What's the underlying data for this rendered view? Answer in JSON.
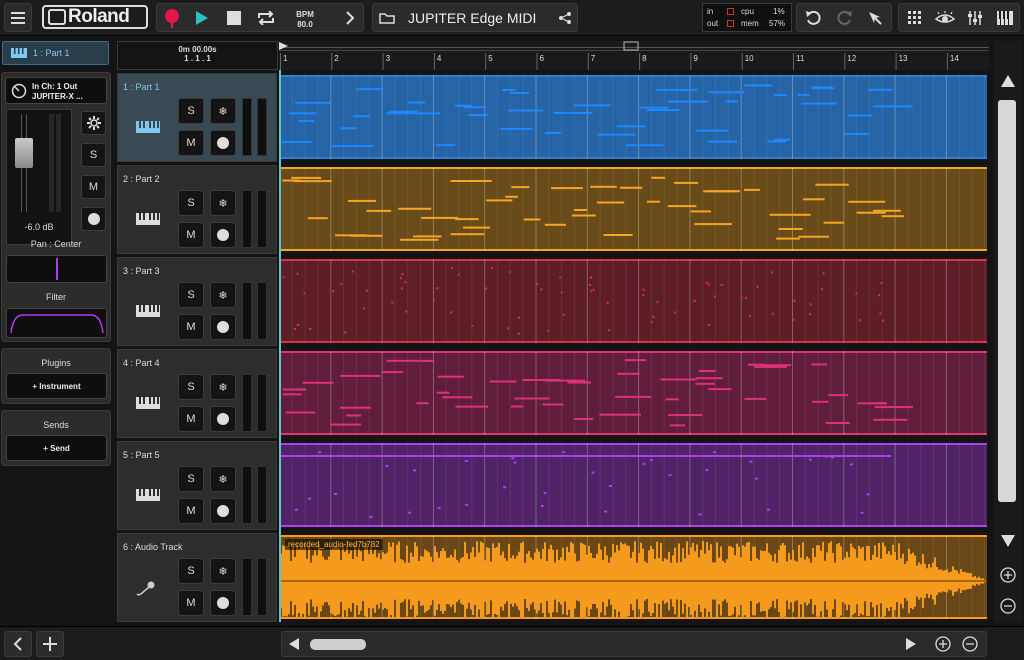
{
  "topbar": {
    "menu_icon": "hamburger-menu-icon",
    "brand": "Roland",
    "bpm_label": "BPM",
    "bpm_value": "80.0",
    "song_title": "JUPITER Edge MIDI",
    "meters": {
      "in": "in",
      "out": "out",
      "cpu_label": "cpu",
      "cpu_value": "1%",
      "mem_label": "mem",
      "mem_value": "57%"
    }
  },
  "inspector": {
    "tab_label": "1 : Part 1",
    "io_line1": "In  Ch: 1 Out",
    "io_line2": "JUPITER-X ...",
    "volume": "-6.0 dB",
    "solo": "S",
    "mute": "M",
    "pan_label": "Pan : Center",
    "filter_label": "Filter",
    "plugins_label": "Plugins",
    "add_instrument": "+ Instrument",
    "sends_label": "Sends",
    "add_send": "+ Send"
  },
  "transport": {
    "time": "0m 00.00s",
    "position": "1 . 1 . 1"
  },
  "ruler": {
    "bars": [
      "1",
      "2",
      "3",
      "4",
      "5",
      "6",
      "7",
      "8",
      "9",
      "10",
      "11",
      "12",
      "13",
      "14"
    ]
  },
  "tracks": [
    {
      "name": "1 : Part 1",
      "color": "#2e7fd6",
      "type": "midi",
      "selected": true
    },
    {
      "name": "2 : Part 2",
      "color": "#f5a524",
      "type": "midi",
      "selected": false
    },
    {
      "name": "3 : Part 3",
      "color": "#d8304a",
      "type": "midi",
      "selected": false
    },
    {
      "name": "4 : Part 4",
      "color": "#e0307a",
      "type": "midi",
      "selected": false
    },
    {
      "name": "5 : Part 5",
      "color": "#b23cf0",
      "type": "midi",
      "selected": false
    },
    {
      "name": "6 : Audio Track",
      "color": "#f59a1c",
      "type": "audio",
      "selected": false
    }
  ],
  "track_buttons": {
    "solo": "S",
    "mute": "M"
  },
  "audio_clip_label": "recorded_audio-fed7b782",
  "icons": {
    "record": "record-icon",
    "play": "play-icon",
    "stop": "stop-icon",
    "loop": "loop-icon",
    "forward": "chevron-right-icon",
    "folder": "folder-icon",
    "share": "share-icon",
    "undo": "undo-icon",
    "redo": "redo-icon",
    "pointer": "pointer-tool-icon",
    "grid": "grid-icon",
    "eye": "eye-icon",
    "mixer": "mixer-icon",
    "keyboard": "keyboard-icon"
  },
  "colors": {
    "accent": "#5ec8c8",
    "record": "#e8174a",
    "play": "#29c2c2"
  }
}
